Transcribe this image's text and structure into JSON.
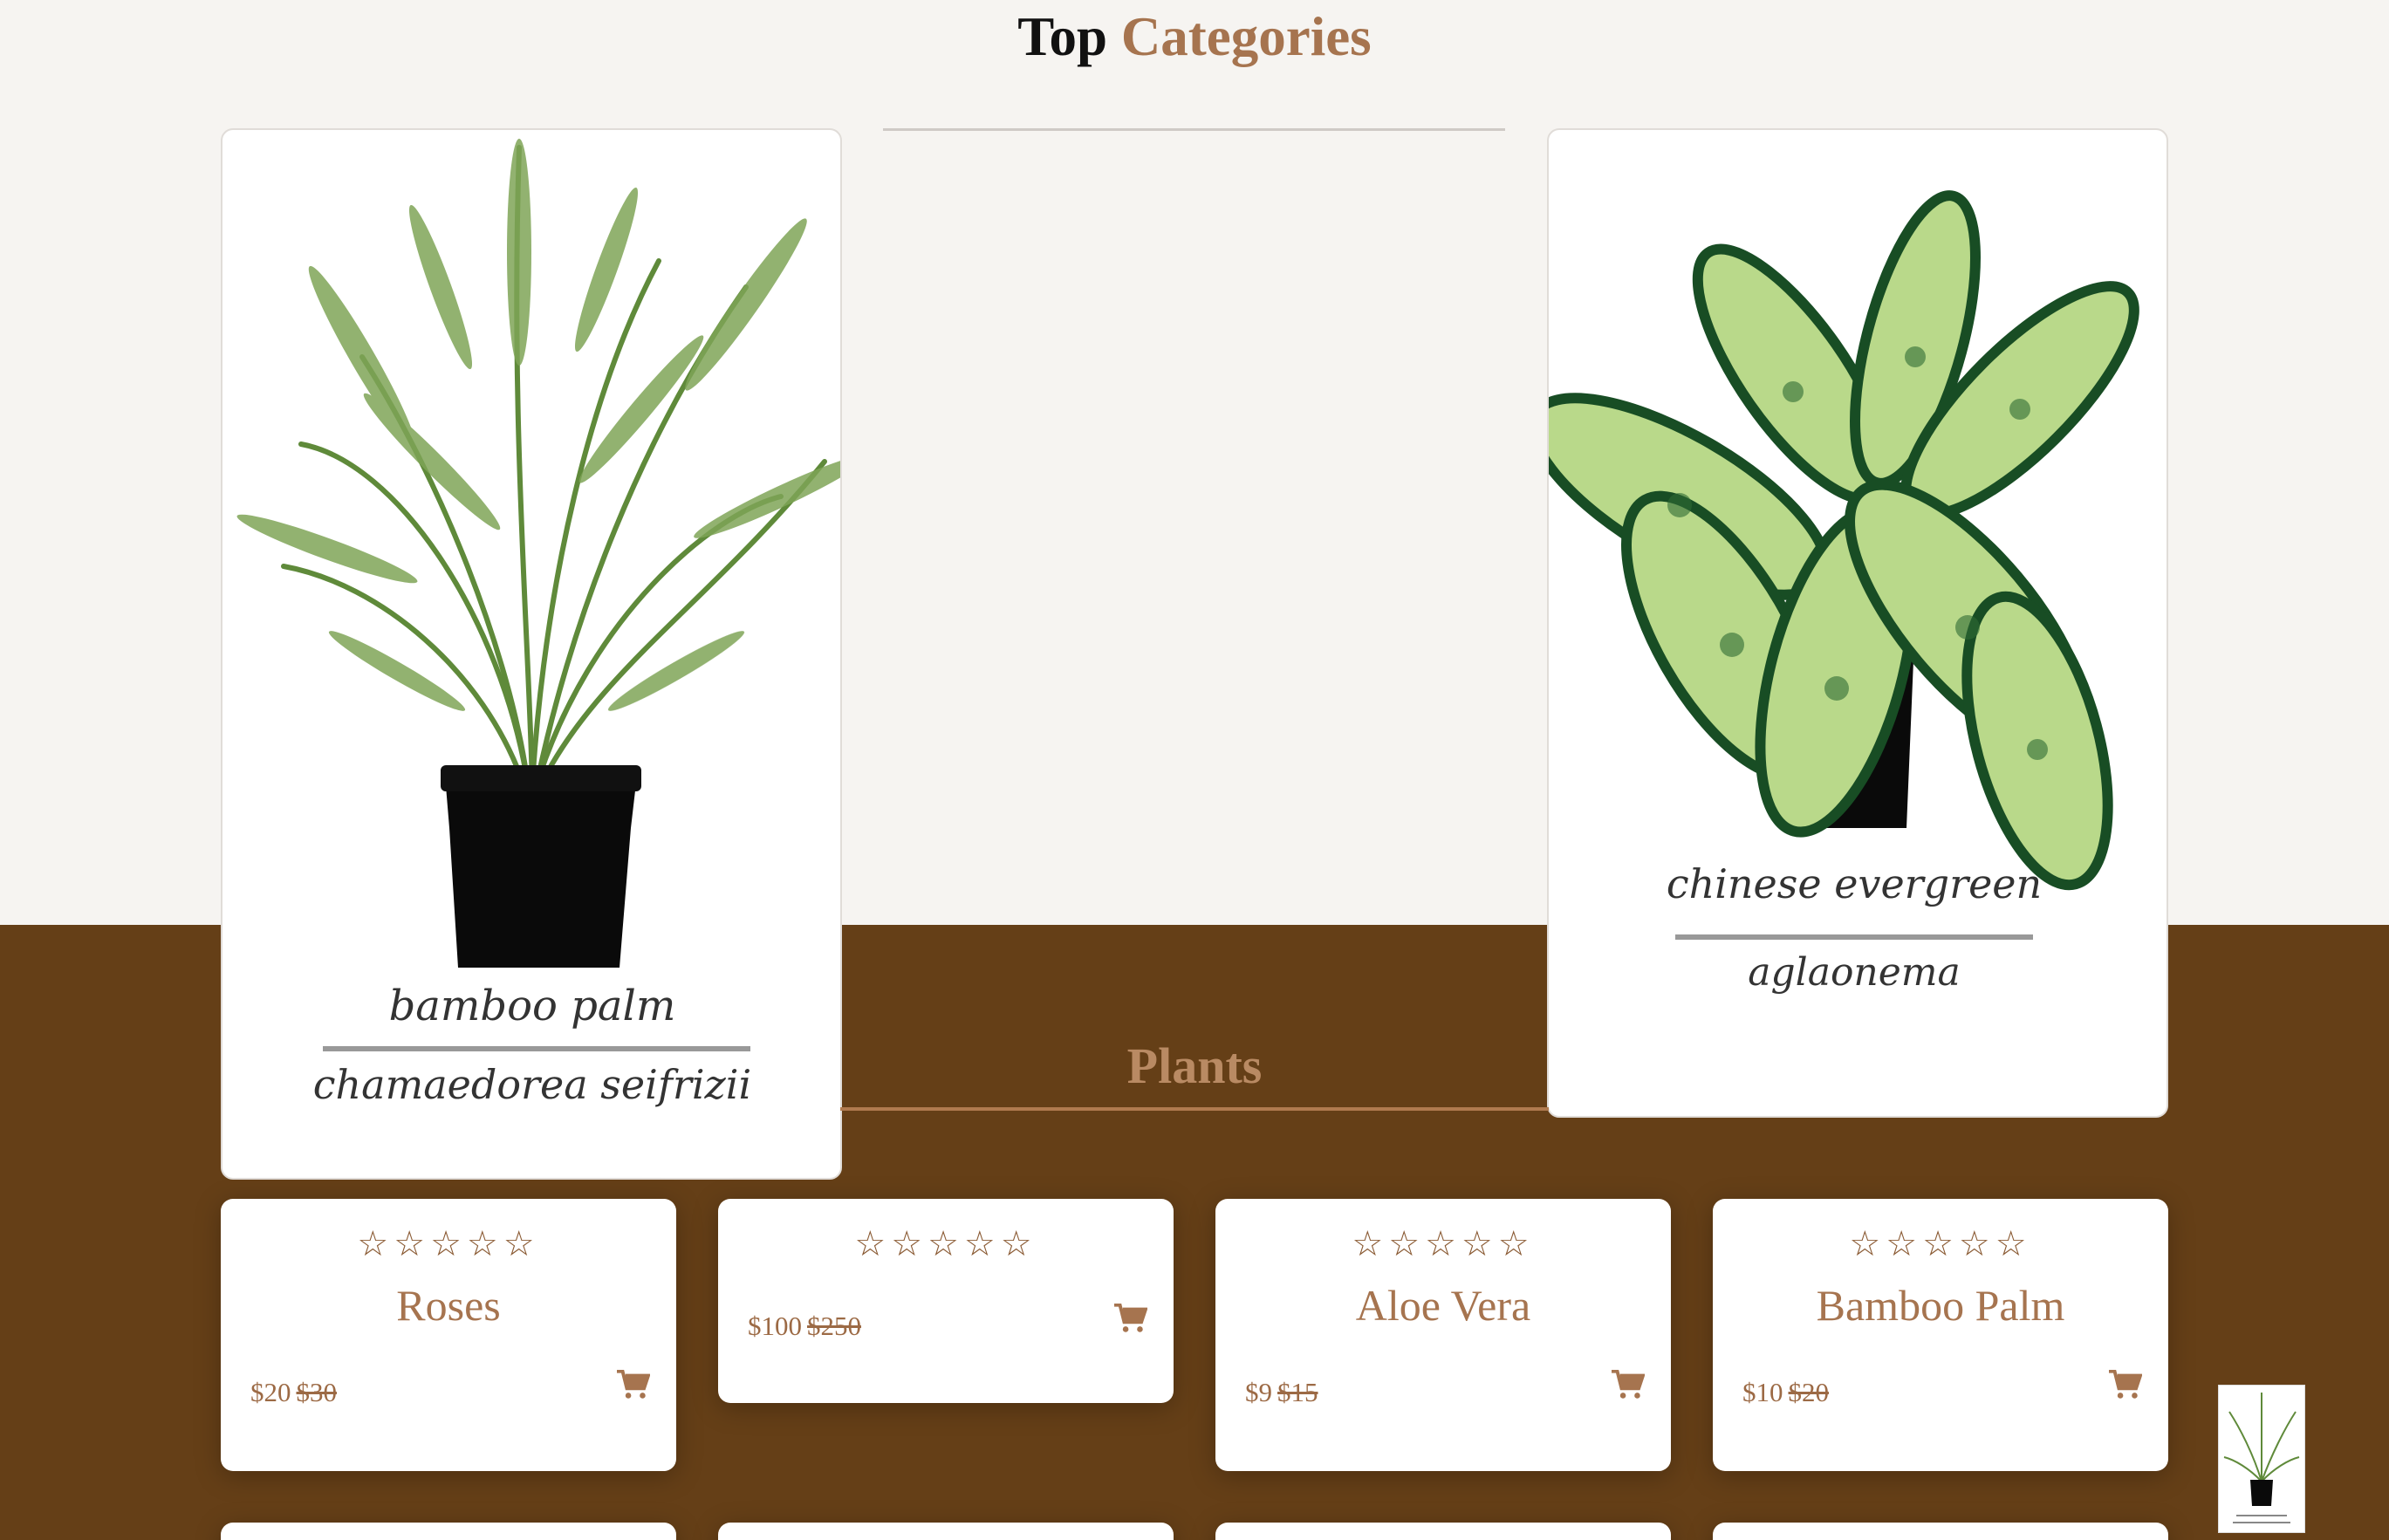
{
  "section": {
    "title_dark": "Top",
    "title_accent": "Categories"
  },
  "categories": [
    {
      "name": "bamboo palm",
      "latin": "chamaedorea seifrizii"
    },
    {
      "name": "chinese evergreen",
      "latin": "aglaonema"
    }
  ],
  "plants": {
    "title": "Plants"
  },
  "stars": "☆☆☆☆☆",
  "products": [
    {
      "name": "Roses",
      "price": "$20",
      "old_price": "$30",
      "rating": 0
    },
    {
      "name": "",
      "price": "$100",
      "old_price": "$250",
      "rating": 0
    },
    {
      "name": "Aloe Vera",
      "price": "$9",
      "old_price": "$15",
      "rating": 0
    },
    {
      "name": "Bamboo Palm",
      "price": "$10",
      "old_price": "$20",
      "rating": 0
    }
  ],
  "colors": {
    "brown_band": "#653f17",
    "accent": "#a6744f",
    "page_bg": "#f6f4f1"
  },
  "icons": {
    "cart": "cart-icon",
    "star": "star-outline-icon"
  }
}
